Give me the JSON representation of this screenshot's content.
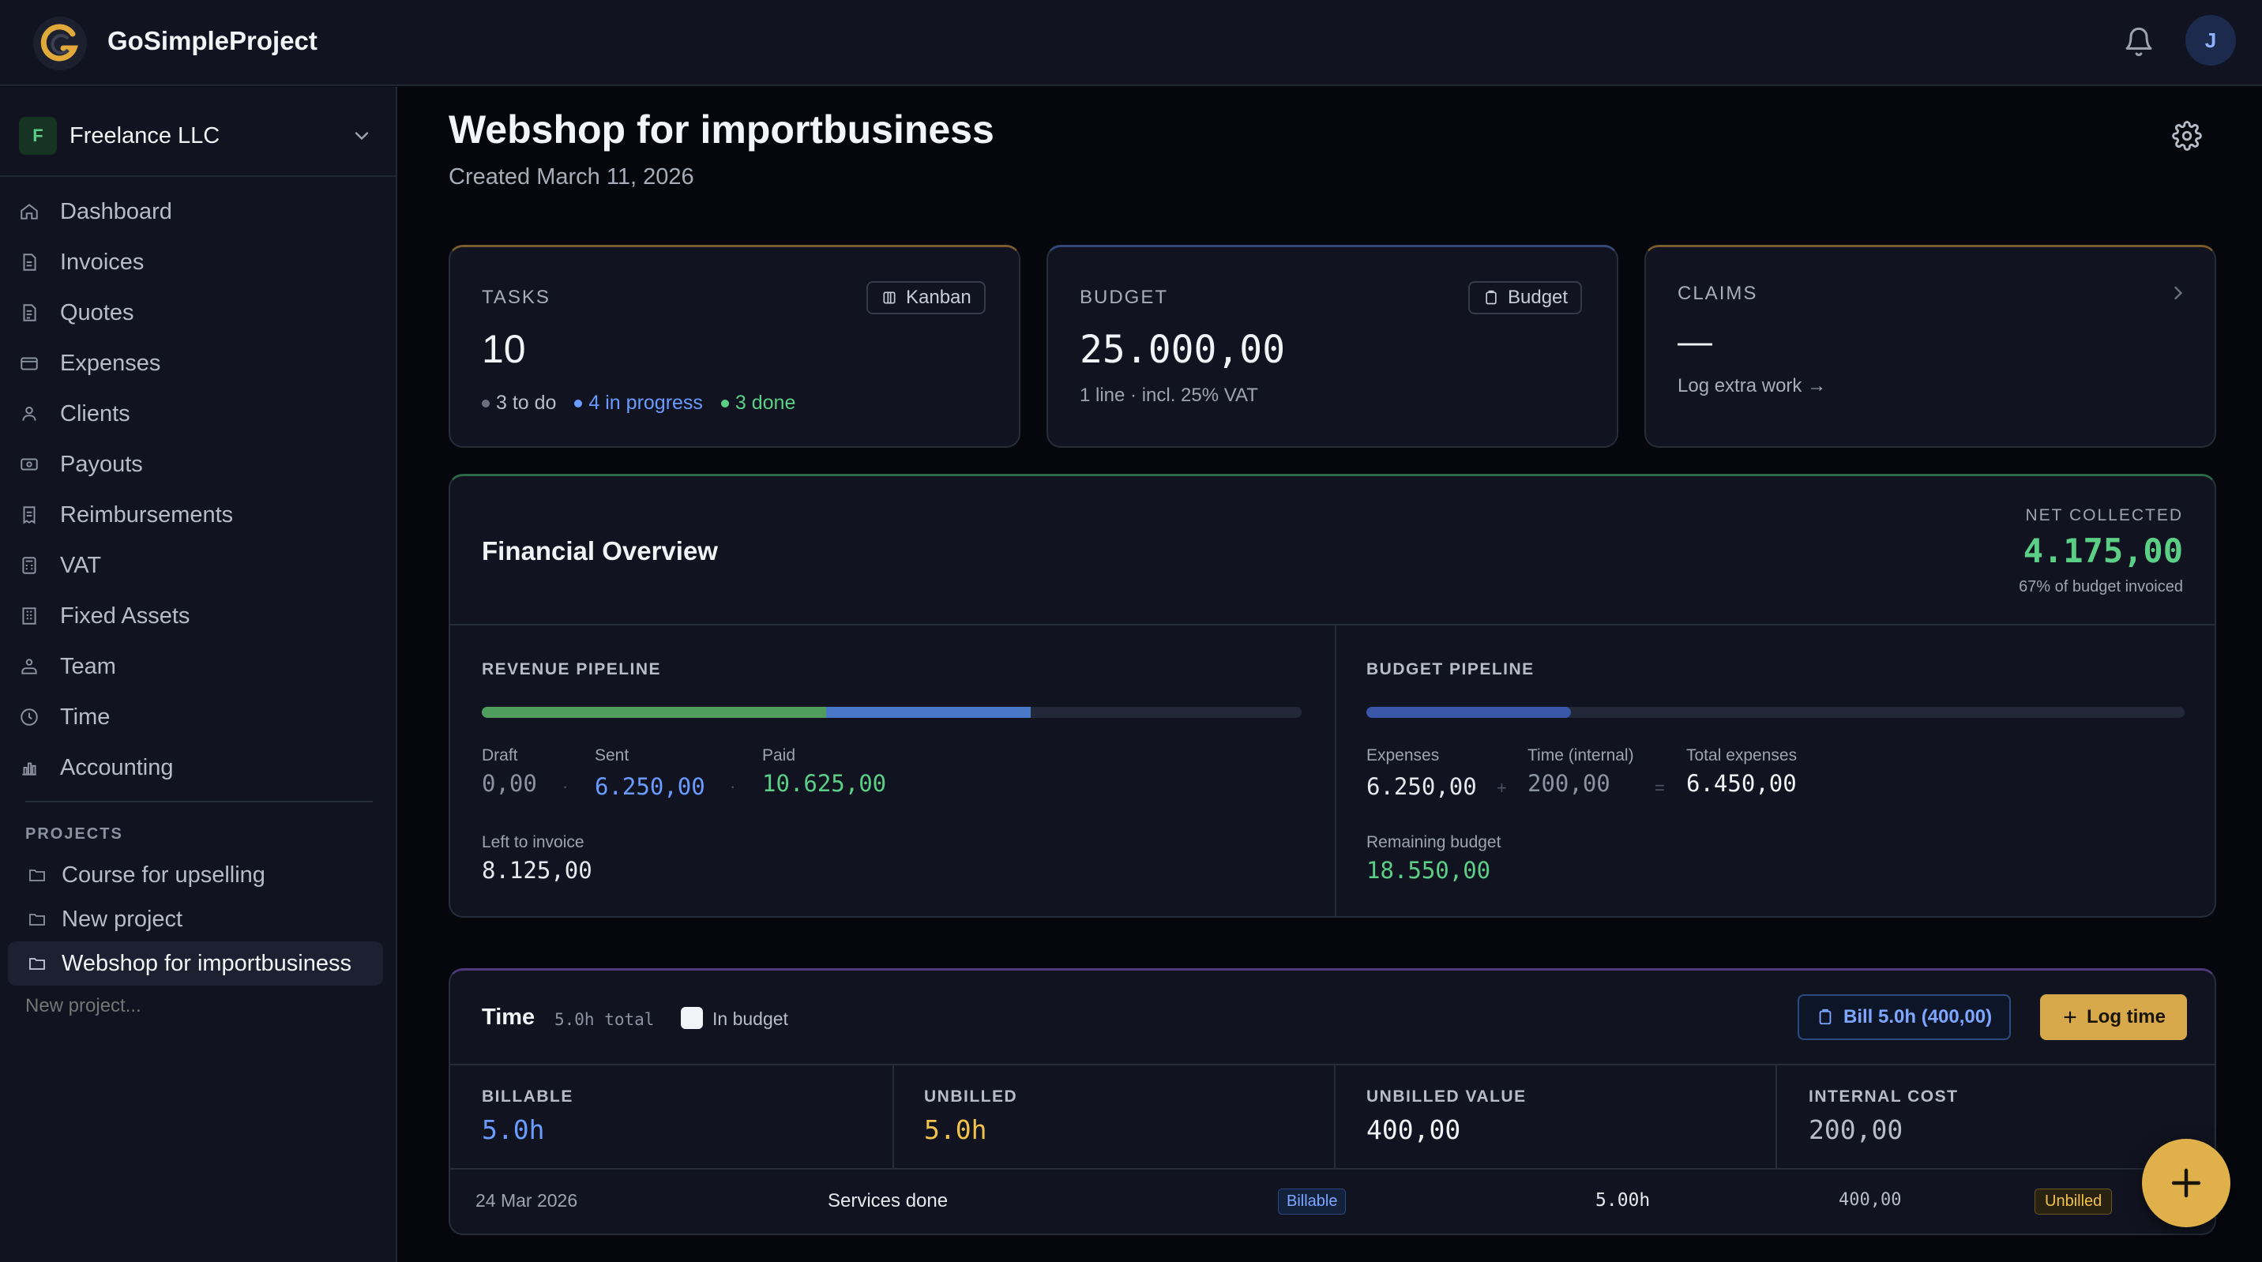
{
  "app": {
    "name": "GoSimpleProject",
    "user_initial": "J"
  },
  "org": {
    "initial": "F",
    "name": "Freelance LLC"
  },
  "nav": [
    {
      "label": "Dashboard",
      "icon": "home-icon"
    },
    {
      "label": "Invoices",
      "icon": "document-icon"
    },
    {
      "label": "Quotes",
      "icon": "document-icon"
    },
    {
      "label": "Expenses",
      "icon": "credit-card-icon"
    },
    {
      "label": "Clients",
      "icon": "users-icon"
    },
    {
      "label": "Payouts",
      "icon": "cash-icon"
    },
    {
      "label": "Reimbursements",
      "icon": "receipt-icon"
    },
    {
      "label": "VAT",
      "icon": "calculator-icon"
    },
    {
      "label": "Fixed Assets",
      "icon": "building-icon"
    },
    {
      "label": "Team",
      "icon": "team-icon"
    },
    {
      "label": "Time",
      "icon": "clock-icon"
    },
    {
      "label": "Accounting",
      "icon": "bar-chart-icon"
    }
  ],
  "projects": {
    "heading": "PROJECTS",
    "items": [
      "Course for upselling",
      "New project",
      "Webshop for importbusiness"
    ],
    "new_placeholder": "New project..."
  },
  "page": {
    "title": "Webshop for importbusiness",
    "subtitle": "Created March 11, 2026"
  },
  "tasks": {
    "label": "TASKS",
    "button": "Kanban",
    "count": "10",
    "todo": "3 to do",
    "in_progress": "4 in progress",
    "done": "3 done"
  },
  "budget": {
    "label": "BUDGET",
    "button": "Budget",
    "amount": "25.000,00",
    "note": "1 line · incl. 25% VAT"
  },
  "claims": {
    "label": "CLAIMS",
    "value": "—",
    "link": "Log extra work →"
  },
  "financial": {
    "title": "Financial Overview",
    "net_label": "NET COLLECTED",
    "net_value": "4.175,00",
    "net_note": "67% of budget invoiced",
    "revenue": {
      "label": "REVENUE PIPELINE",
      "paid_fraction": 0.42,
      "sent_fraction": 0.25,
      "draft_label": "Draft",
      "draft_value": "0,00",
      "sent_label": "Sent",
      "sent_value": "6.250,00",
      "paid_label": "Paid",
      "paid_value": "10.625,00",
      "left_label": "Left to invoice",
      "left_value": "8.125,00",
      "sep": "·"
    },
    "budget_pipeline": {
      "label": "BUDGET PIPELINE",
      "used_fraction": 0.25,
      "expenses_label": "Expenses",
      "expenses_value": "6.250,00",
      "time_label": "Time (internal)",
      "time_value": "200,00",
      "total_label": "Total expenses",
      "total_value": "6.450,00",
      "remaining_label": "Remaining budget",
      "remaining_value": "18.550,00",
      "plus": "+",
      "equals": "="
    }
  },
  "time": {
    "title": "Time",
    "total": "5.0h total",
    "in_budget_label": "In budget",
    "bill_button": "Bill 5.0h (400,00)",
    "log_button": "Log time",
    "stats": [
      {
        "label": "BILLABLE",
        "value": "5.0h"
      },
      {
        "label": "UNBILLED",
        "value": "5.0h"
      },
      {
        "label": "UNBILLED VALUE",
        "value": "400,00"
      },
      {
        "label": "INTERNAL COST",
        "value": "200,00"
      }
    ],
    "entry": {
      "date": "24 Mar 2026",
      "description": "Services done",
      "type": "Billable",
      "hours": "5.00h",
      "amount": "400,00",
      "status": "Unbilled"
    }
  },
  "colors": {
    "accent_gold": "#e0b04a",
    "green": "#5ccf86",
    "blue": "#6a9bff",
    "yellow": "#f0c24b"
  }
}
